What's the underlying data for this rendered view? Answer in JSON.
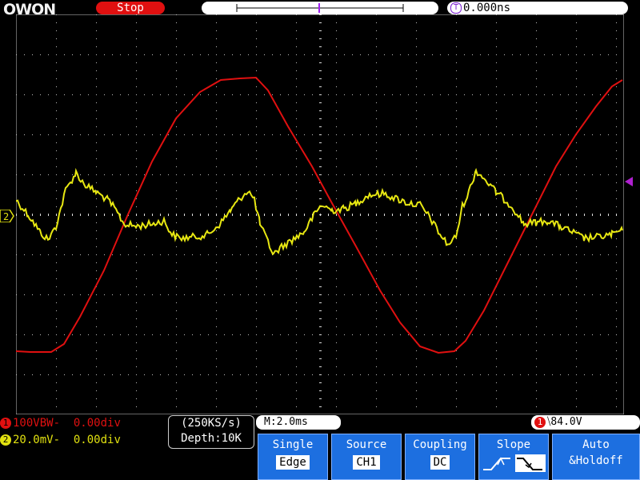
{
  "brand": "OWON",
  "status": "Stop",
  "trigger_position": "0.000ns",
  "trigger_marker": "T",
  "channels": [
    {
      "icon": "1",
      "label": "100VBW-",
      "offset": "0.00div",
      "color": "#e01010"
    },
    {
      "icon": "2",
      "label": "20.0mV-",
      "offset": "0.00div",
      "color": "#e0e010"
    }
  ],
  "ch2_marker": "2",
  "sample_rate": "(250KS/s)",
  "depth": "Depth:10K",
  "timebase": "M:2.0ms",
  "trigger": {
    "icon": "1",
    "level": "84.0V"
  },
  "menu": [
    {
      "label": "Single",
      "value": "Edge"
    },
    {
      "label": "Source",
      "value": "CH1"
    },
    {
      "label": "Coupling",
      "value": "DC"
    },
    {
      "label": "Slope",
      "value": ""
    },
    {
      "label": "Auto",
      "value": "&Holdoff"
    }
  ],
  "colors": {
    "ch1": "#e01010",
    "ch2": "#e0e010",
    "grid": "#c8c8c8",
    "accent": "#1d6fe0"
  }
}
